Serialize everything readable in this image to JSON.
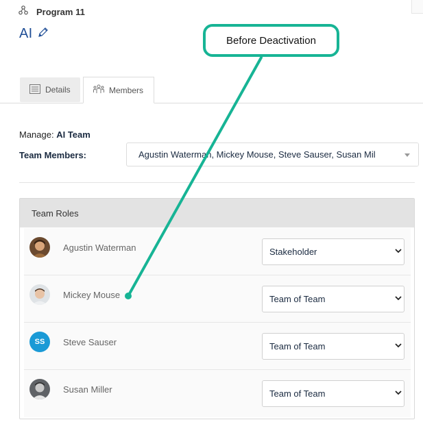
{
  "breadcrumb": {
    "icon": "program-icon",
    "label": "Program 11"
  },
  "page": {
    "title": "AI",
    "edit_icon": "pencil-icon"
  },
  "tabs": [
    {
      "label": "Details",
      "icon": "document-icon",
      "active": false
    },
    {
      "label": "Members",
      "icon": "people-icon",
      "active": true
    }
  ],
  "manage": {
    "prefix": "Manage:",
    "team": "AI Team"
  },
  "team_members": {
    "label": "Team Members:",
    "value": "Agustin Waterman, Mickey Mouse, Steve Sauser, Susan Mil"
  },
  "roles_panel": {
    "title": "Team Roles",
    "members": [
      {
        "name": "Agustin Waterman",
        "avatar": "photo",
        "role": "Stakeholder"
      },
      {
        "name": "Mickey Mouse",
        "avatar": "photo",
        "role": "Team of Team"
      },
      {
        "name": "Steve Sauser",
        "avatar": "initials",
        "initials": "SS",
        "role": "Team of Team"
      },
      {
        "name": "Susan Miller",
        "avatar": "photo",
        "role": "Team of Team"
      }
    ]
  },
  "annotation": {
    "text": "Before Deactivation",
    "color": "#17b495"
  },
  "colors": {
    "title": "#1f4e96",
    "accent": "#17b495",
    "initials_avatar": "#1a9ad6"
  }
}
